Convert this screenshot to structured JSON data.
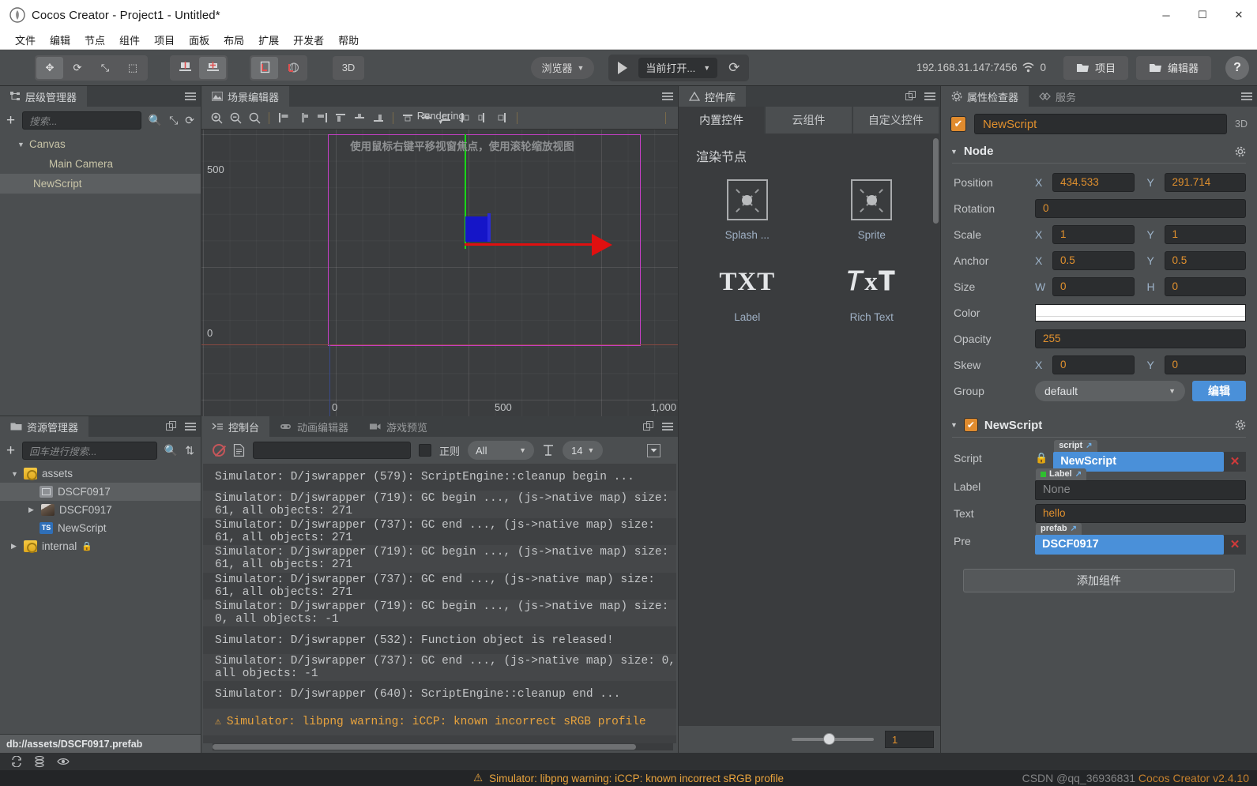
{
  "window": {
    "title": "Cocos Creator - Project1 - Untitled*",
    "logo_icon": "cocos-logo-icon",
    "minimize": "─",
    "maximize": "☐",
    "close": "✕"
  },
  "menubar": {
    "items": [
      "文件",
      "编辑",
      "节点",
      "组件",
      "项目",
      "面板",
      "布局",
      "扩展",
      "开发者",
      "帮助"
    ]
  },
  "toolbar": {
    "transform_tools": [
      {
        "name": "move-tool",
        "glyph": "✥"
      },
      {
        "name": "rotate-tool",
        "glyph": "⟳"
      },
      {
        "name": "scale-tool",
        "glyph": "⤡"
      },
      {
        "name": "rect-tool",
        "glyph": "⬚"
      }
    ],
    "pivot_tools": [
      {
        "name": "pivot-tool",
        "glyph": "┳"
      },
      {
        "name": "center-tool",
        "glyph": "┻"
      }
    ],
    "coord_tools": [
      {
        "name": "local-coord-tool",
        "glyph": "⬒"
      },
      {
        "name": "global-coord-tool",
        "glyph": "⬓"
      }
    ],
    "mode_3d": "3D",
    "browser_label": "浏览器",
    "open_target_label": "当前打开...",
    "refresh_icon": "refresh-icon",
    "play_icon": "play-icon",
    "ip_address": "192.168.31.147:7456",
    "wifi_icon": "wifi-icon",
    "device_count": "0",
    "project_button": "项目",
    "editor_button": "编辑器",
    "help_button": "?"
  },
  "hierarchy": {
    "tab_label": "层级管理器",
    "tab_icon": "hierarchy-icon",
    "add_icon": "plus-icon",
    "search_placeholder": "搜索...",
    "search_icon": "search-icon",
    "collapse_icon": "collapse-icon",
    "refresh_icon": "refresh-icon",
    "menu_icon": "hamburger-icon",
    "nodes": [
      {
        "label": "Canvas",
        "depth": 0,
        "expanded": true,
        "selected": false,
        "has_arrow": true
      },
      {
        "label": "Main Camera",
        "depth": 1,
        "expanded": false,
        "selected": false,
        "has_arrow": false
      },
      {
        "label": "NewScript",
        "depth": 0,
        "expanded": false,
        "selected": true,
        "has_arrow": false
      }
    ]
  },
  "assets": {
    "tab_label": "资源管理器",
    "tab_icon": "folder-icon",
    "popout_icon": "popout-icon",
    "menu_icon": "hamburger-icon",
    "add_icon": "plus-icon",
    "search_placeholder": "回车进行搜索...",
    "search_icon": "search-icon",
    "sort_icon": "sort-icon",
    "items": [
      {
        "label": "assets",
        "depth": 0,
        "icon": "folder-icon",
        "arrow": "down",
        "selected": false,
        "lock": false
      },
      {
        "label": "DSCF0917",
        "depth": 2,
        "icon": "prefab-icon",
        "arrow": "none",
        "selected": true,
        "lock": false
      },
      {
        "label": "DSCF0917",
        "depth": 1,
        "icon": "image-icon",
        "arrow": "right",
        "selected": false,
        "lock": false
      },
      {
        "label": "NewScript",
        "depth": 2,
        "icon": "typescript-icon",
        "arrow": "none",
        "selected": false,
        "lock": false
      },
      {
        "label": "internal",
        "depth": 0,
        "icon": "folder-icon",
        "arrow": "right",
        "selected": false,
        "lock": true
      }
    ],
    "path": "db://assets/DSCF0917.prefab"
  },
  "scene": {
    "tab_label": "场景编辑器",
    "tab_icon": "scene-icon",
    "menu_icon": "hamburger-icon",
    "zoom_in_icon": "zoom-in-icon",
    "zoom_out_icon": "zoom-out-icon",
    "zoom_reset_icon": "zoom-fit-icon",
    "align_tools": [
      "align-left-icon",
      "align-hcenter-icon",
      "align-right-icon",
      "align-top-icon",
      "align-vcenter-icon",
      "align-bottom-icon"
    ],
    "distribute_tools": [
      "dist-top-icon",
      "dist-middle-icon",
      "dist-bottom-icon",
      "dist-left-icon",
      "dist-center-icon",
      "dist-right-icon"
    ],
    "rendering_label": "Rendering",
    "hint": "使用鼠标右键平移视窗焦点，使用滚轮缩放视图",
    "axis_labels": {
      "y_top": "500",
      "y_zero": "0",
      "x_zero": "0",
      "x_mid": "500",
      "x_end": "1,000"
    }
  },
  "widget_library": {
    "tab_label": "控件库",
    "tab_icon": "widget-icon",
    "popout_icon": "popout-icon",
    "menu_icon": "hamburger-icon",
    "tabs": [
      {
        "label": "内置控件",
        "active": true
      },
      {
        "label": "云组件",
        "active": false
      },
      {
        "label": "自定义控件",
        "active": false
      }
    ],
    "section_title": "渲染节点",
    "items": [
      {
        "label": "Splash ...",
        "icon": "splash-node-icon",
        "kind": "box"
      },
      {
        "label": "Sprite",
        "icon": "sprite-node-icon",
        "kind": "box"
      },
      {
        "label": "Label",
        "icon": "label-node-icon",
        "kind": "text",
        "glyph": "TXT"
      },
      {
        "label": "Rich Text",
        "icon": "richtext-node-icon",
        "kind": "text",
        "glyph": "𝑇x𝐓"
      }
    ],
    "zoom_value": "1"
  },
  "inspector": {
    "tabs": [
      {
        "label": "属性检查器",
        "icon": "gear-icon",
        "active": true
      },
      {
        "label": "服务",
        "icon": "service-icon",
        "active": false
      }
    ],
    "menu_icon": "hamburger-icon",
    "node_enabled": true,
    "node_name": "NewScript",
    "mode_3d": "3D",
    "node_section": {
      "title": "Node",
      "gear_icon": "gear-icon",
      "rows": [
        {
          "label": "Position",
          "type": "xy",
          "x_axis": "X",
          "x": "434.533",
          "y_axis": "Y",
          "y": "291.714"
        },
        {
          "label": "Rotation",
          "type": "single",
          "value": "0"
        },
        {
          "label": "Scale",
          "type": "xy",
          "x_axis": "X",
          "x": "1",
          "y_axis": "Y",
          "y": "1"
        },
        {
          "label": "Anchor",
          "type": "xy",
          "x_axis": "X",
          "x": "0.5",
          "y_axis": "Y",
          "y": "0.5"
        },
        {
          "label": "Size",
          "type": "xy",
          "x_axis": "W",
          "x": "0",
          "y_axis": "H",
          "y": "0"
        },
        {
          "label": "Color",
          "type": "color",
          "value": "#ffffff"
        },
        {
          "label": "Opacity",
          "type": "single",
          "value": "255"
        },
        {
          "label": "Skew",
          "type": "xy",
          "x_axis": "X",
          "x": "0",
          "y_axis": "Y",
          "y": "0"
        },
        {
          "label": "Group",
          "type": "select",
          "value": "default",
          "button": "编辑"
        }
      ]
    },
    "component_section": {
      "enabled": true,
      "title": "NewScript",
      "gear_icon": "gear-icon",
      "rows": [
        {
          "label": "Script",
          "tag": "script",
          "tag_dot": false,
          "value": "NewScript",
          "filled": true,
          "lock": true,
          "clear": "✕"
        },
        {
          "label": "Label",
          "tag": "Label",
          "tag_dot": true,
          "value": "None",
          "filled": false,
          "lock": false,
          "clear": ""
        },
        {
          "label": "Text",
          "tag": "",
          "tag_dot": false,
          "value": "hello",
          "filled": false,
          "plain": true,
          "lock": false,
          "clear": ""
        },
        {
          "label": "Pre",
          "tag": "prefab",
          "tag_dot": false,
          "value": "DSCF0917",
          "filled": true,
          "lock": false,
          "clear": "✕"
        }
      ],
      "add_component_label": "添加组件"
    }
  },
  "console": {
    "tabs": [
      {
        "label": "控制台",
        "icon": "console-icon",
        "active": true
      },
      {
        "label": "动画编辑器",
        "icon": "animation-icon",
        "active": false
      },
      {
        "label": "游戏预览",
        "icon": "camera-icon",
        "active": false
      }
    ],
    "popout_icon": "popout-icon",
    "menu_icon": "hamburger-icon",
    "clear_icon": "clear-icon",
    "file_icon": "file-icon",
    "filter_value": "",
    "regex_label": "正则",
    "regex_checked": false,
    "level_filter": "All",
    "font_icon": "font-size-icon",
    "font_size": "14",
    "collapse_icon": "collapse-down-icon",
    "logs": [
      {
        "text": "Simulator: D/jswrapper (579): ScriptEngine::cleanup begin ...",
        "level": "info"
      },
      {
        "text": "Simulator: D/jswrapper (719): GC begin ..., (js->native map) size: 61, all objects: 271",
        "level": "info"
      },
      {
        "text": "Simulator: D/jswrapper (737): GC end ..., (js->native map) size: 61, all objects: 271",
        "level": "info"
      },
      {
        "text": "Simulator: D/jswrapper (719): GC begin ..., (js->native map) size: 61, all objects: 271",
        "level": "info"
      },
      {
        "text": "Simulator: D/jswrapper (737): GC end ..., (js->native map) size: 61, all objects: 271",
        "level": "info"
      },
      {
        "text": "Simulator: D/jswrapper (719): GC begin ..., (js->native map) size: 0, all objects: -1",
        "level": "info"
      },
      {
        "text": "Simulator: D/jswrapper (532): Function object is released!",
        "level": "info"
      },
      {
        "text": "Simulator: D/jswrapper (737): GC end ..., (js->native map) size: 0, all objects: -1",
        "level": "info"
      },
      {
        "text": "Simulator: D/jswrapper (640): ScriptEngine::cleanup end ...",
        "level": "info"
      },
      {
        "text": "Simulator: libpng warning: iCCP: known incorrect sRGB profile",
        "level": "warn"
      }
    ]
  },
  "statusbar": {
    "icons": [
      "sync-icon",
      "database-icon",
      "eye-icon"
    ],
    "warn_icon": "warning-icon",
    "message": "Simulator: libpng warning: iCCP: known incorrect sRGB profile",
    "watermark": "CSDN @qq_36936831",
    "watermark2": "Cocos Creator v2.4.10"
  },
  "colors": {
    "accent_orange": "#e0902e",
    "accent_blue": "#4a90d9",
    "panel_bg": "#4b4e50",
    "dark_bg": "#3a3c3e",
    "warn": "#e8a33d"
  }
}
